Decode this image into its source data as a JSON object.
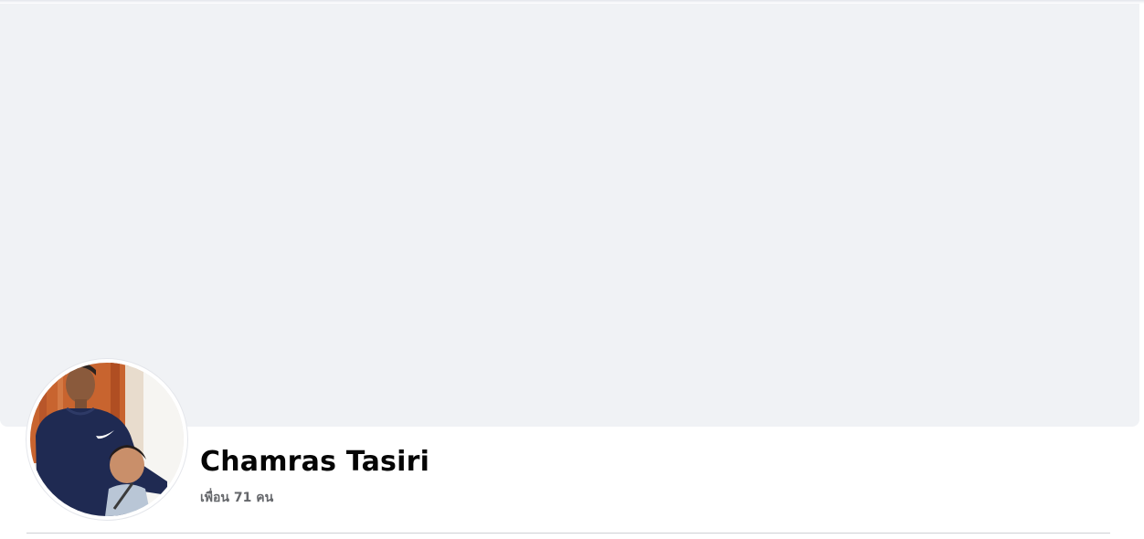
{
  "profile": {
    "name": "Chamras Tasiri",
    "friends_text": "เพื่อน 71 คน"
  },
  "cover": {
    "color": "#f0f2f5"
  },
  "avatar": {
    "icon": "profile-photo"
  },
  "colors": {
    "name_text": "#050505",
    "secondary_text": "#65676b",
    "divider": "#ced0d4"
  }
}
